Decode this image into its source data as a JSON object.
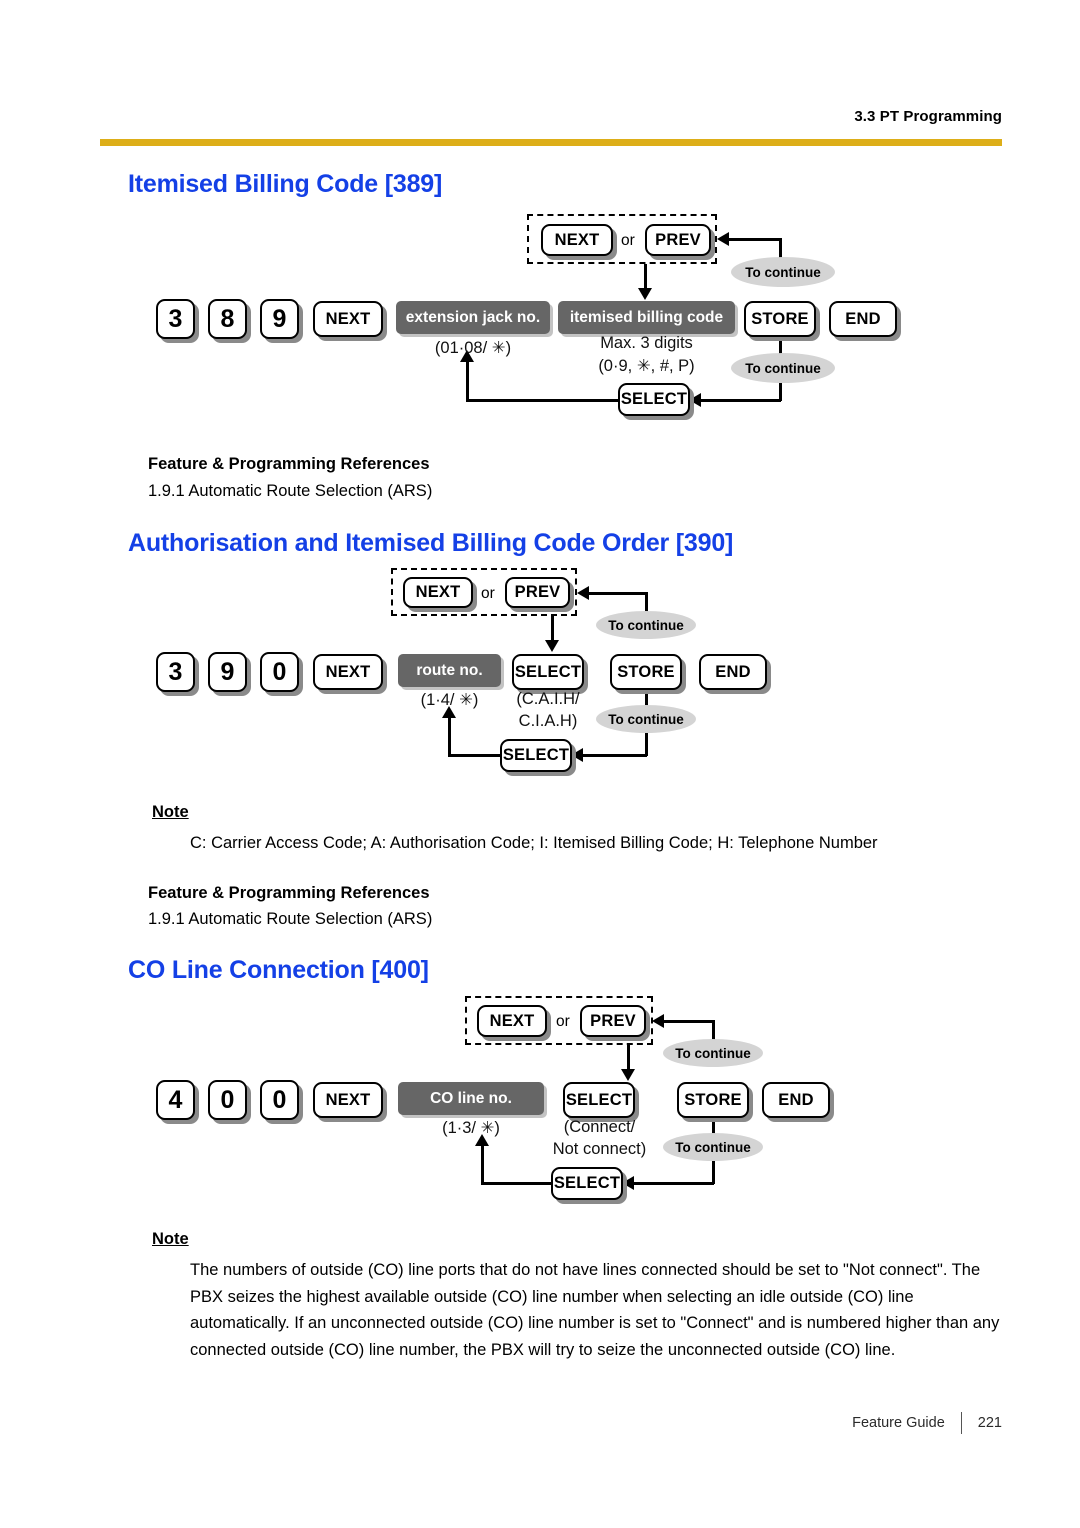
{
  "header": {
    "section": "3.3 PT Programming"
  },
  "footer": {
    "doc_title": "Feature Guide",
    "page_number": "221"
  },
  "colors": {
    "heading_blue": "#1440e6",
    "rule_gold": "#ddae18",
    "gray_box": "#666666",
    "ellipse_gray": "#d4d4d4"
  },
  "sections": [
    {
      "title": "Itemised Billing Code [389]",
      "diagram": {
        "digits": [
          "3",
          "8",
          "9"
        ],
        "next_key": "NEXT",
        "toggle_group": {
          "next": "NEXT",
          "or": "or",
          "prev": "PREV"
        },
        "gray_fields": [
          {
            "label": "extension jack no.",
            "caption": "(01·08/ ✳)"
          },
          {
            "label": "itemised billing code",
            "caption_line1": "Max. 3 digits",
            "caption_line2": "(0·9, ✳, #, P)"
          }
        ],
        "store": "STORE",
        "end": "END",
        "select": "SELECT",
        "to_continue_upper": "To continue",
        "to_continue_lower": "To continue"
      },
      "references": {
        "heading": "Feature & Programming References",
        "items": [
          "1.9.1 Automatic Route Selection (ARS)"
        ]
      }
    },
    {
      "title": "Authorisation and Itemised Billing Code Order [390]",
      "diagram": {
        "digits": [
          "3",
          "9",
          "0"
        ],
        "next_key": "NEXT",
        "toggle_group": {
          "next": "NEXT",
          "or": "or",
          "prev": "PREV"
        },
        "gray_fields": [
          {
            "label": "route no.",
            "caption": "(1·4/ ✳)"
          }
        ],
        "select_top": "SELECT",
        "select_top_caption_line1": "(C.A.I.H/",
        "select_top_caption_line2": "C.I.A.H)",
        "store": "STORE",
        "end": "END",
        "select": "SELECT",
        "to_continue_upper": "To continue",
        "to_continue_lower": "To continue"
      },
      "note": {
        "heading": "Note",
        "body": "C: Carrier Access Code; A: Authorisation Code; I: Itemised Billing Code; H: Telephone Number"
      },
      "references": {
        "heading": "Feature & Programming References",
        "items": [
          "1.9.1 Automatic Route Selection (ARS)"
        ]
      }
    },
    {
      "title": "CO Line Connection [400]",
      "diagram": {
        "digits": [
          "4",
          "0",
          "0"
        ],
        "next_key": "NEXT",
        "toggle_group": {
          "next": "NEXT",
          "or": "or",
          "prev": "PREV"
        },
        "gray_fields": [
          {
            "label": "CO line no.",
            "caption": "(1·3/ ✳)"
          }
        ],
        "select_top": "SELECT",
        "select_top_caption_line1": "(Connect/",
        "select_top_caption_line2": "Not connect)",
        "store": "STORE",
        "end": "END",
        "select": "SELECT",
        "to_continue_upper": "To continue",
        "to_continue_lower": "To continue"
      },
      "note": {
        "heading": "Note",
        "body": "The numbers of outside (CO) line ports that do not have lines connected should be set to \"Not connect\". The PBX seizes the highest available outside (CO) line number when selecting an idle outside (CO) line automatically. If an unconnected outside (CO) line number is set to \"Connect\" and is numbered higher than any connected outside (CO) line number, the PBX will try to seize the unconnected outside (CO) line."
      }
    }
  ]
}
